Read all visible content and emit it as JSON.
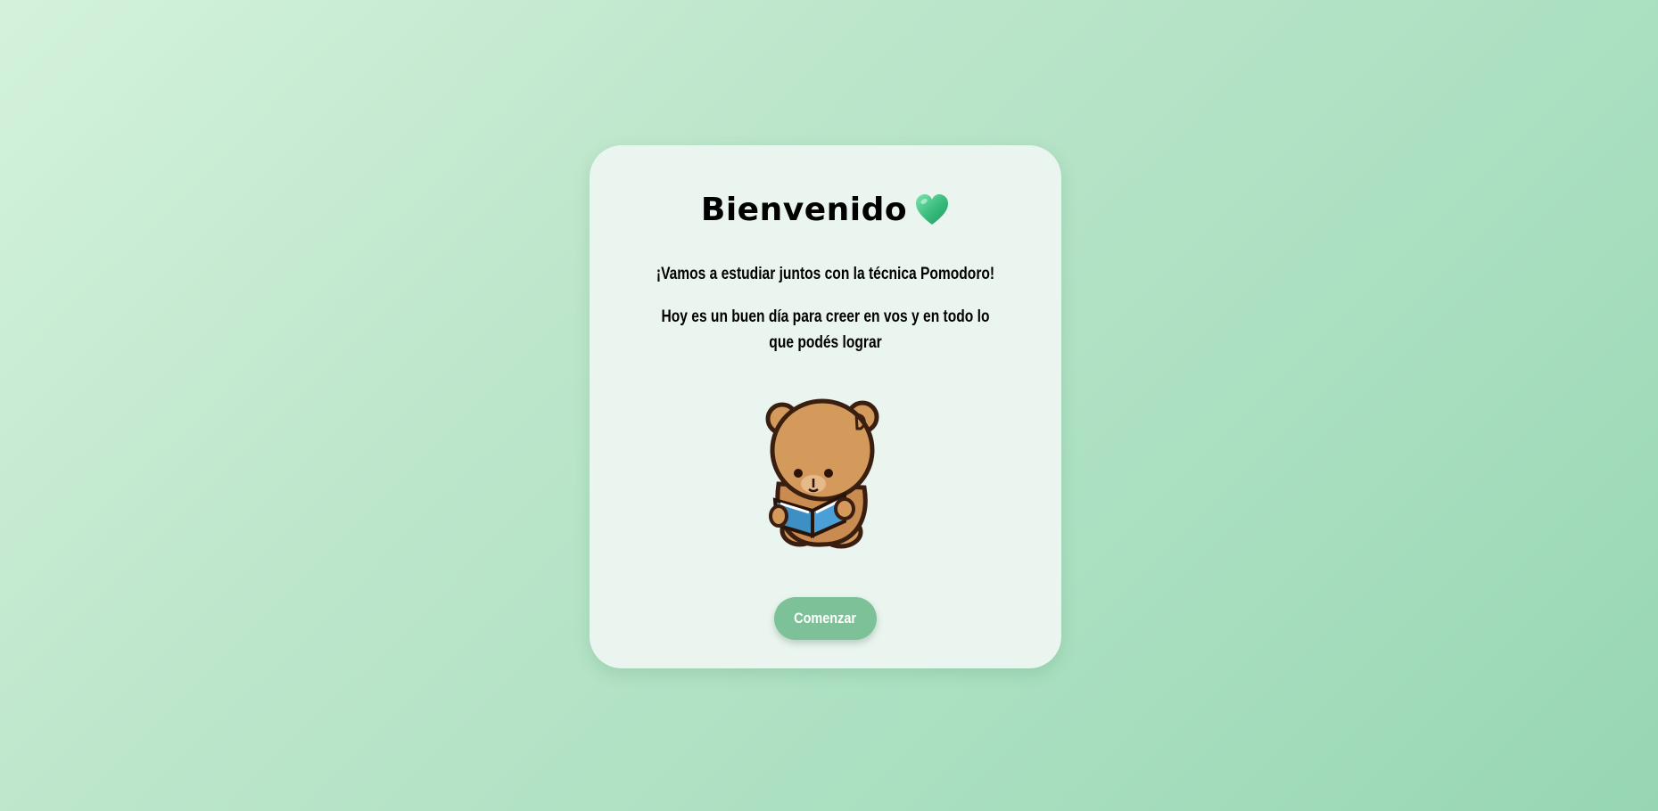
{
  "welcome": {
    "title": "Bienvenido",
    "heart_icon": "green-heart-icon",
    "subtitle": "¡Vamos a estudiar juntos con la técnica Pomodoro!",
    "message": "Hoy es un buen día para creer en vos y en todo lo que podés lograr",
    "illustration": "bear-reading-book-icon",
    "start_button_label": "Comenzar"
  },
  "colors": {
    "card_background": "#ebf5ef",
    "button": "#7cc197",
    "heart": "#3dbd80"
  }
}
